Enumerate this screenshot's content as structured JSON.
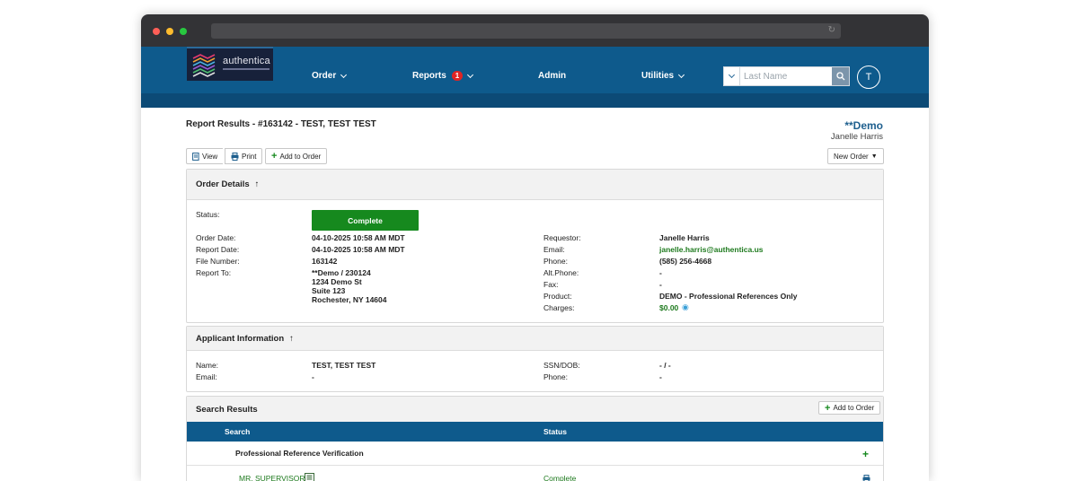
{
  "browser": {
    "dots": [
      "#ff5f57",
      "#febc2e",
      "#28c840"
    ]
  },
  "logo": {
    "text": "authentica"
  },
  "nav": {
    "order": "Order",
    "reports": "Reports",
    "reports_badge": "1",
    "admin": "Admin",
    "utilities": "Utilities"
  },
  "search": {
    "placeholder": "Last Name"
  },
  "user": {
    "initial": "T"
  },
  "page": {
    "title": "Report Results - #163142 - TEST, TEST TEST",
    "account": "**Demo",
    "account_user": "Janelle Harris"
  },
  "toolbar": {
    "view": "View",
    "print": "Print",
    "add_to_order": "Add to Order",
    "new_order": "New Order"
  },
  "order_details": {
    "heading": "Order Details",
    "status_label": "Status:",
    "status_value": "Complete",
    "order_date_label": "Order Date:",
    "order_date": "04-10-2025 10:58 AM MDT",
    "report_date_label": "Report Date:",
    "report_date": "04-10-2025 10:58 AM MDT",
    "file_number_label": "File Number:",
    "file_number": "163142",
    "report_to_label": "Report To:",
    "report_to_lines": [
      "**Demo / 230124",
      "1234 Demo St",
      "Suite 123",
      "Rochester, NY 14604"
    ],
    "requestor_label": "Requestor:",
    "requestor": "Janelle Harris",
    "email_label": "Email:",
    "email": "janelle.harris@authentica.us",
    "phone_label": "Phone:",
    "phone": "(585) 256-4668",
    "alt_phone_label": "Alt.Phone:",
    "alt_phone": "-",
    "fax_label": "Fax:",
    "fax": "-",
    "product_label": "Product:",
    "product": "DEMO - Professional References Only",
    "charges_label": "Charges:",
    "charges": "$0.00"
  },
  "applicant": {
    "heading": "Applicant Information",
    "name_label": "Name:",
    "name": "TEST, TEST TEST",
    "email_label": "Email:",
    "email": "-",
    "ssn_label": "SSN/DOB:",
    "ssn": "- / -",
    "phone_label": "Phone:",
    "phone": "-"
  },
  "search_results": {
    "heading": "Search Results",
    "add_to_order": "Add to Order",
    "col_search": "Search",
    "col_status": "Status",
    "group": "Professional Reference Verification",
    "item_name": "MR. SUPERVISOR",
    "item_status": "Complete"
  },
  "colors": {
    "nav": "#0e5a8c",
    "accent_green": "#16891e",
    "brand_blue": "#1e5f8e"
  }
}
